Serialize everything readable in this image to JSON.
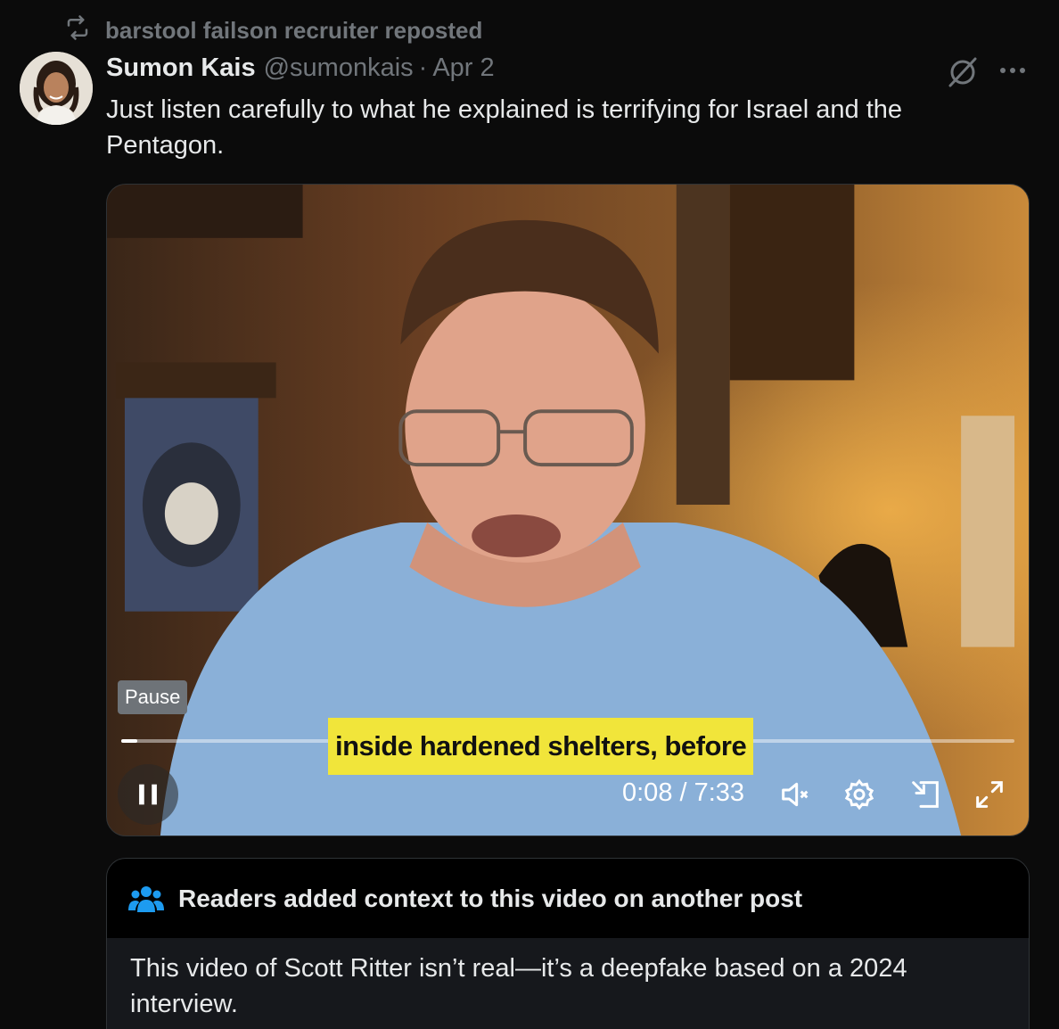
{
  "repost": {
    "icon": "repost-icon",
    "label": "barstool failson recruiter reposted"
  },
  "tweet": {
    "author_name": "Sumon Kais",
    "author_handle": "@sumonkais",
    "separator": "·",
    "date": "Apr 2",
    "text": "Just listen carefully to what he explained is terrifying for Israel and the Pentagon."
  },
  "video": {
    "pause_tooltip": "Pause",
    "caption": "inside hardened shelters, before",
    "progress": 0.018,
    "time": "0:08 / 7:33",
    "controls": [
      "pause-icon",
      "mute-icon",
      "settings-icon",
      "pip-icon",
      "fullscreen-icon"
    ]
  },
  "community_note": {
    "icon": "people-icon",
    "title": "Readers added context to this video on another post",
    "body": "This video of Scott Ritter isn’t real—it’s a deepfake based on a 2024 interview."
  },
  "colors": {
    "background": "#0b0b0b",
    "text": "#e7e9ea",
    "muted": "#71767b",
    "accent_blue": "#1d9bf0",
    "caption_yellow": "#f1e53a"
  }
}
